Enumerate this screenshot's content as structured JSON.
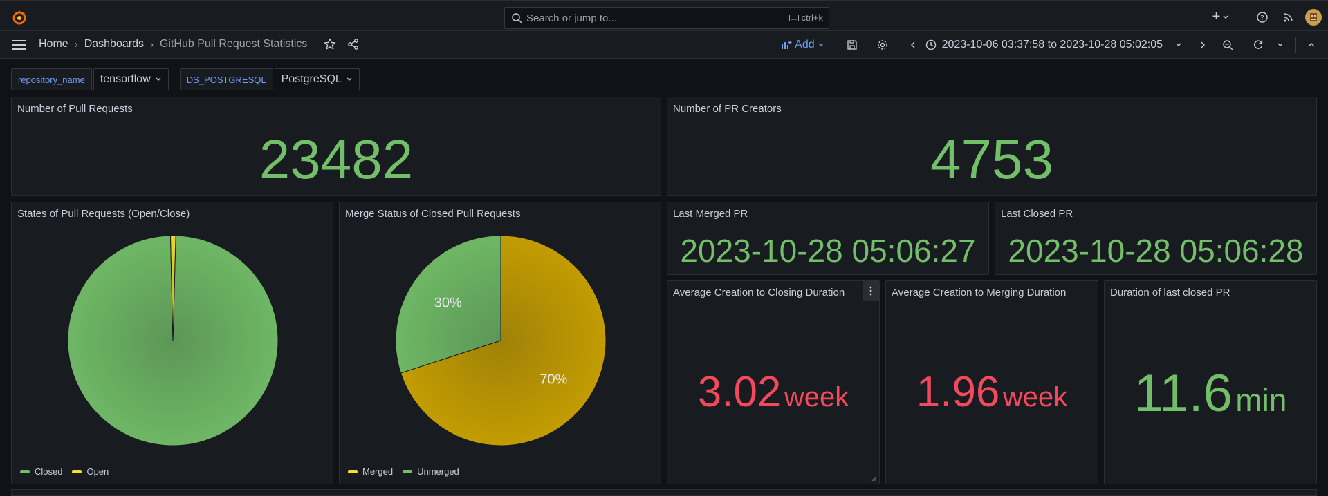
{
  "topbar": {
    "search_placeholder": "Search or jump to...",
    "shortcut": "ctrl+k",
    "plus_label": "+"
  },
  "nav": {
    "crumbs": [
      "Home",
      "Dashboards",
      "GitHub Pull Request Statistics"
    ],
    "add_label": "Add",
    "time_range": "2023-10-06 03:37:58 to 2023-10-28 05:02:05"
  },
  "variables": [
    {
      "name": "repository_name",
      "value": "tensorflow"
    },
    {
      "name": "DS_POSTGRESQL",
      "value": "PostgreSQL"
    }
  ],
  "panels": {
    "pull_requests": {
      "title": "Number of Pull Requests",
      "value": "23482"
    },
    "pr_creators": {
      "title": "Number of PR Creators",
      "value": "4753"
    },
    "states": {
      "title": "States of Pull Requests (Open/Close)",
      "legend": [
        "Closed",
        "Open"
      ]
    },
    "merge_status": {
      "title": "Merge Status of Closed Pull Requests",
      "legend": [
        "Merged",
        "Unmerged"
      ],
      "label_unmerged": "30%",
      "label_merged": "70%"
    },
    "last_merged": {
      "title": "Last Merged PR",
      "value": "2023-10-28 05:06:27"
    },
    "last_closed": {
      "title": "Last Closed PR",
      "value": "2023-10-28 05:06:28"
    },
    "avg_closing": {
      "title": "Average Creation to Closing Duration",
      "value": "3.02",
      "unit": "week"
    },
    "avg_merging": {
      "title": "Average Creation to Merging Duration",
      "value": "1.96",
      "unit": "week"
    },
    "last_duration": {
      "title": "Duration of last closed PR",
      "value": "11.6",
      "unit": "min"
    }
  },
  "chart_data": [
    {
      "type": "pie",
      "categories": [
        "Closed",
        "Open"
      ],
      "values": [
        99.2,
        0.8
      ],
      "colors": [
        "#73bf69",
        "#fade2a"
      ],
      "legend": "bottom-left"
    },
    {
      "type": "pie",
      "categories": [
        "Merged",
        "Unmerged"
      ],
      "values": [
        70,
        30
      ],
      "colors": [
        "#cca300",
        "#73bf69"
      ],
      "legend": "bottom-left"
    }
  ],
  "colors": {
    "green": "#73bf69",
    "red": "#f2495c",
    "yellow": "#cca300",
    "accent": "#6e9fff"
  }
}
